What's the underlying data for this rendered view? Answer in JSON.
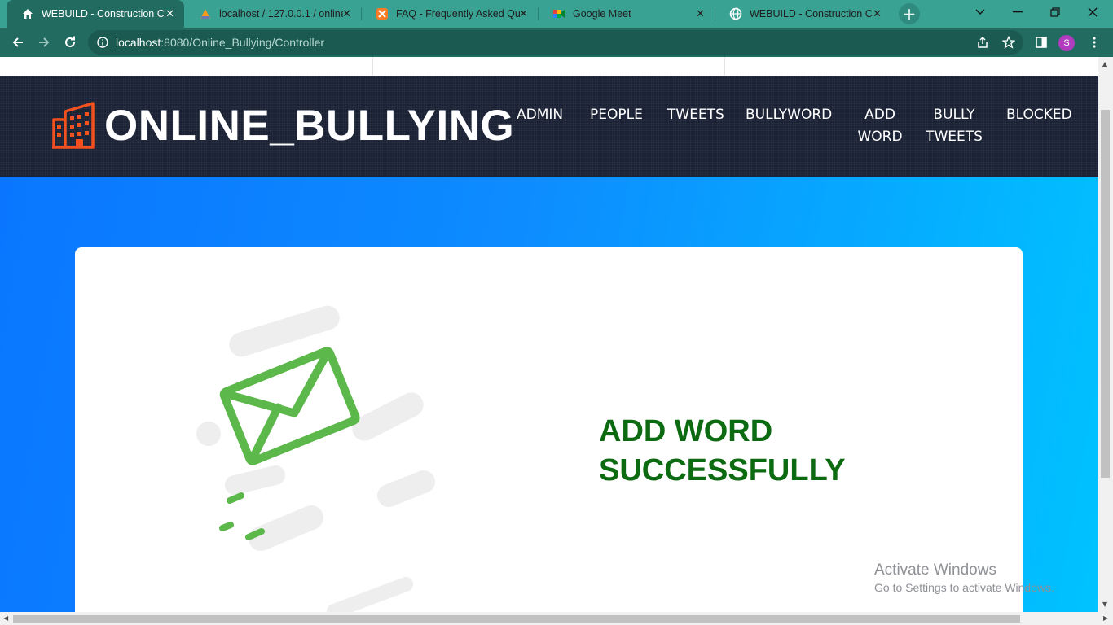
{
  "browser": {
    "tabs": [
      {
        "title": "WEBUILD - Construction Con",
        "icon": "home-icon",
        "active": true
      },
      {
        "title": "localhost / 127.0.0.1 / online",
        "icon": "phpmyadmin-icon",
        "active": false
      },
      {
        "title": "FAQ - Frequently Asked Que",
        "icon": "xampp-icon",
        "active": false
      },
      {
        "title": "Google Meet",
        "icon": "google-meet-icon",
        "active": false
      },
      {
        "title": "WEBUILD - Construction Con",
        "icon": "globe-icon",
        "active": false
      }
    ],
    "close_glyph": "✕",
    "new_tab_glyph": "+",
    "url_host": "localhost",
    "url_rest": ":8080/Online_Bullying/Controller",
    "profile_initial": "S"
  },
  "site": {
    "logo_text": "ONLINE_BULLYING",
    "nav": [
      {
        "lines": [
          "ADMIN"
        ]
      },
      {
        "lines": [
          "PEOPLE"
        ]
      },
      {
        "lines": [
          "TWEETS"
        ]
      },
      {
        "lines": [
          "BULLYWORD"
        ]
      },
      {
        "lines": [
          "ADD",
          "WORD"
        ]
      },
      {
        "lines": [
          "BULLY",
          "TWEETS"
        ]
      },
      {
        "lines": [
          "BLOCKED"
        ]
      }
    ]
  },
  "main": {
    "message_line1": "ADD WORD",
    "message_line2": "SUCCESSFULLY"
  },
  "watermark": {
    "line1": "Activate Windows",
    "line2": "Go to Settings to activate Windows."
  },
  "colors": {
    "tab_strip": "#3aa293",
    "toolbar": "#226b60",
    "header_bg": "#1a2134",
    "logo_orange": "#f0511f",
    "hero_left": "#0a76ff",
    "hero_right": "#00c3ff",
    "message_green": "#0c6a10",
    "envelope_green": "#5cb84a"
  }
}
